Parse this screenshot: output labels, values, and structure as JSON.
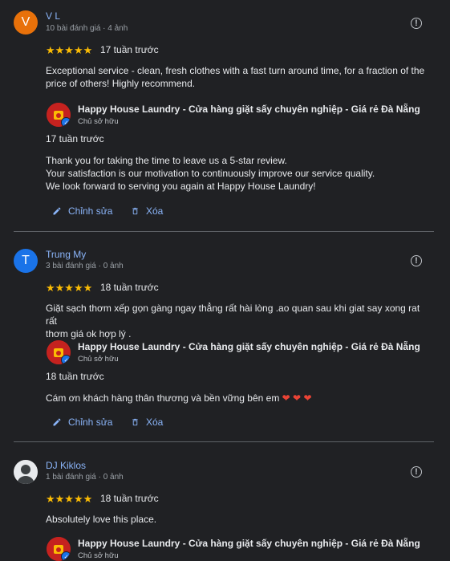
{
  "reviews": [
    {
      "avatar_letter": "V",
      "name": "V L",
      "meta": "10 bài đánh giá · 4 ảnh",
      "stars": "★★★★★",
      "when": "17 tuần trước",
      "text_lines": [
        "Exceptional service - clean, fresh clothes with a fast turn around time, for a fraction of the",
        "price of others! Highly recommend."
      ],
      "owner_name": "Happy House Laundry - Cửa hàng giặt sấy chuyên nghiệp - Giá rẻ Đà Nẵng",
      "owner_role": "Chủ sở hữu",
      "reply_when": "17 tuần trước",
      "reply_lines": [
        "Thank you for taking the time to leave us a 5-star review.",
        "Your satisfaction is our motivation to continuously improve our service quality.",
        "We look forward to serving you again at Happy House Laundry!"
      ],
      "edit_label": "Chỉnh sửa",
      "delete_label": "Xóa"
    },
    {
      "avatar_letter": "T",
      "name": "Trung My",
      "meta": "3 bài đánh giá · 0 ảnh",
      "stars": "★★★★★",
      "when": "18 tuần trước",
      "text_lines": [
        "Giặt sạch thơm xếp gọn gàng ngay thẳng rất hài lòng .ao quan sau khi giat say xong rat rất",
        "thơm giá ok hợp lý ."
      ],
      "owner_name": "Happy House Laundry - Cửa hàng giặt sấy chuyên nghiệp - Giá rẻ Đà Nẵng",
      "owner_role": "Chủ sở hữu",
      "reply_when": "18 tuần trước",
      "reply_text": "Cám ơn khách hàng thân thương và bền vững bên em",
      "reply_hearts": "❤ ❤ ❤",
      "edit_label": "Chỉnh sửa",
      "delete_label": "Xóa"
    },
    {
      "name": "DJ Kiklos",
      "meta": "1 bài đánh giá · 0 ảnh",
      "stars": "★★★★★",
      "when": "18 tuần trước",
      "text": "Absolutely love this place.",
      "owner_name": "Happy House Laundry - Cửa hàng giặt sấy chuyên nghiệp - Giá rẻ Đà Nẵng",
      "owner_role": "Chủ sở hữu"
    }
  ],
  "icons": {
    "info": "!",
    "edit": "pencil-icon",
    "delete": "trash-icon",
    "verified": "✓"
  },
  "colors": {
    "background": "#202124",
    "link": "#8ab4f8",
    "star": "#fbbc04",
    "heart": "#ea4335"
  }
}
